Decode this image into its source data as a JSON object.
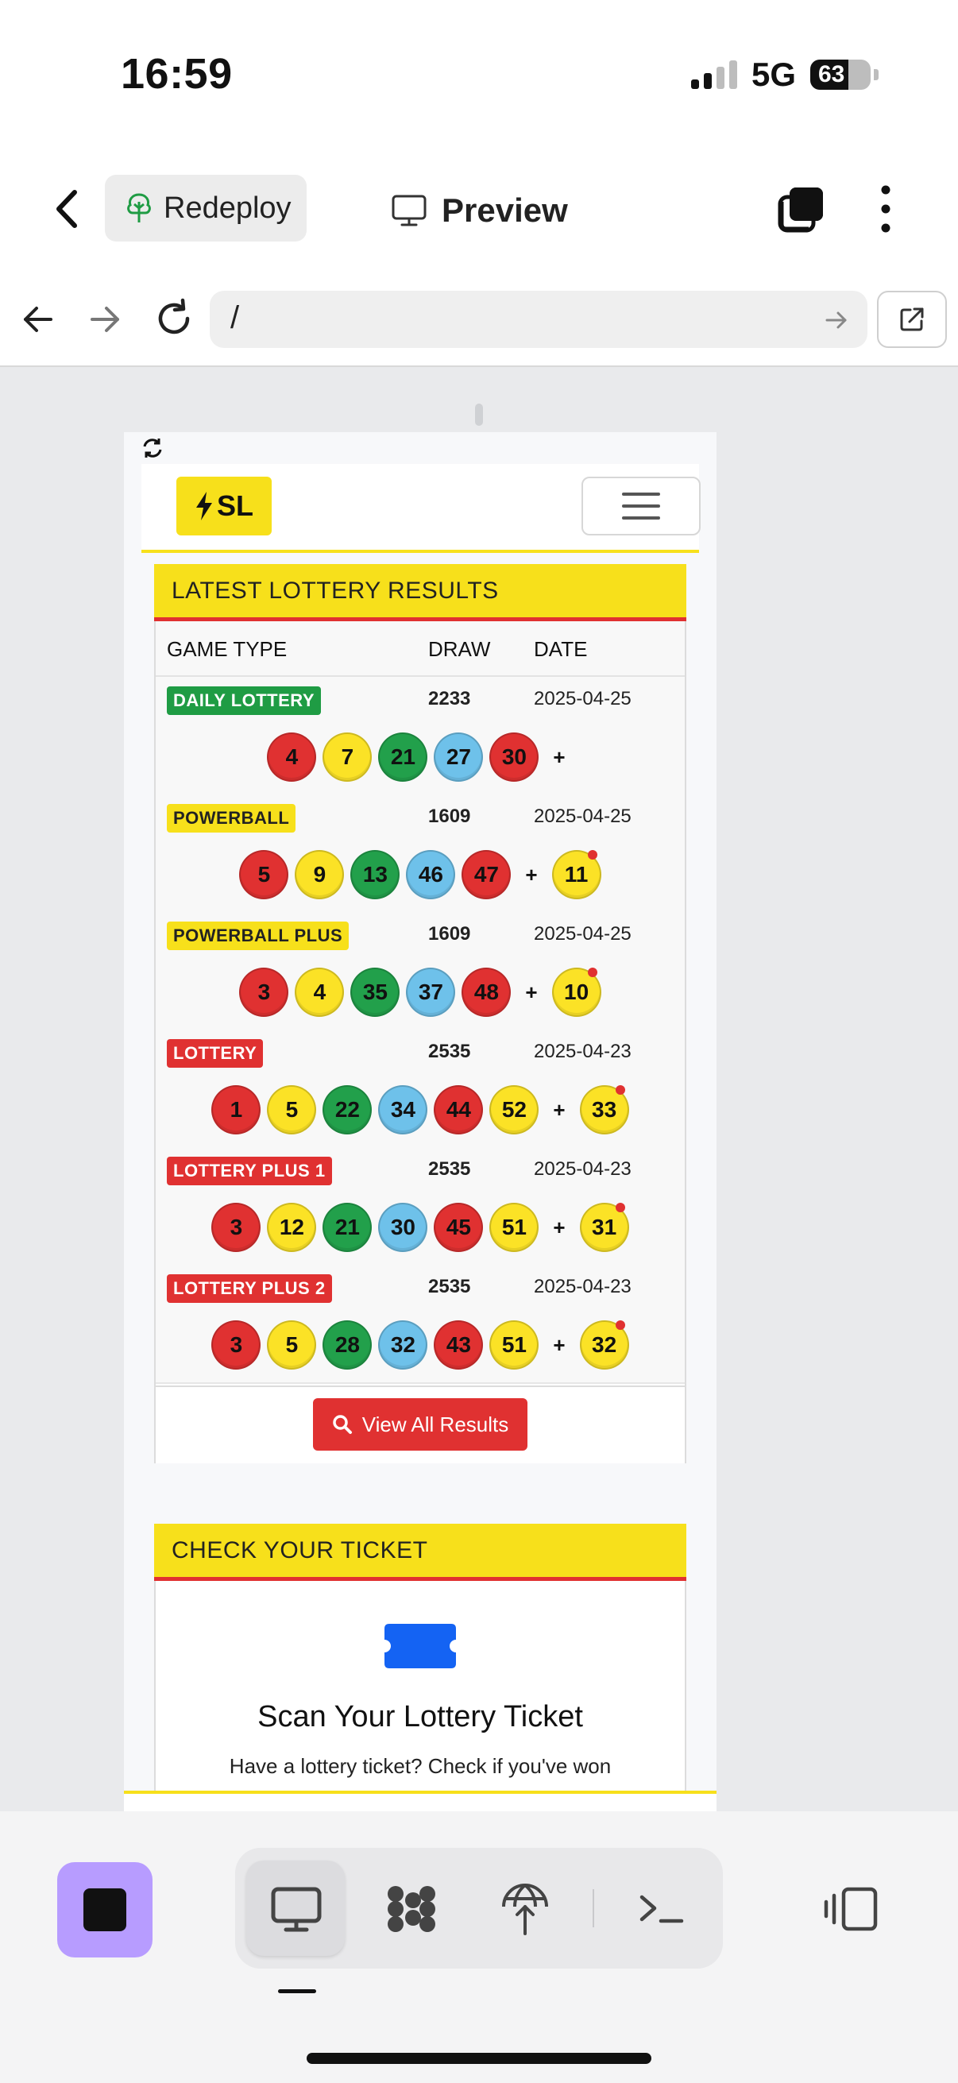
{
  "status_bar": {
    "time": "16:59",
    "network": "5G",
    "battery": "63",
    "battery_level": 0.63
  },
  "header": {
    "redeploy_label": "Redeploy",
    "preview_label": "Preview"
  },
  "url_bar": {
    "url": "/"
  },
  "site": {
    "logo_text": "SL",
    "results_title": "LATEST LOTTERY RESULTS",
    "columns": {
      "game_type": "GAME TYPE",
      "draw": "DRAW",
      "date": "DATE"
    },
    "plus_sign": "+",
    "games": [
      {
        "name": "DAILY LOTTERY",
        "badge_color": "green",
        "draw": "2233",
        "date": "2025-04-25",
        "numbers": [
          {
            "n": "4",
            "c": "red"
          },
          {
            "n": "7",
            "c": "yellow"
          },
          {
            "n": "21",
            "c": "green"
          },
          {
            "n": "27",
            "c": "blue"
          },
          {
            "n": "30",
            "c": "red"
          }
        ],
        "bonus": ""
      },
      {
        "name": "POWERBALL",
        "badge_color": "yellow",
        "draw": "1609",
        "date": "2025-04-25",
        "numbers": [
          {
            "n": "5",
            "c": "red"
          },
          {
            "n": "9",
            "c": "yellow"
          },
          {
            "n": "13",
            "c": "green"
          },
          {
            "n": "46",
            "c": "blue"
          },
          {
            "n": "47",
            "c": "red"
          }
        ],
        "bonus": "11"
      },
      {
        "name": "POWERBALL PLUS",
        "badge_color": "yellow",
        "draw": "1609",
        "date": "2025-04-25",
        "numbers": [
          {
            "n": "3",
            "c": "red"
          },
          {
            "n": "4",
            "c": "yellow"
          },
          {
            "n": "35",
            "c": "green"
          },
          {
            "n": "37",
            "c": "blue"
          },
          {
            "n": "48",
            "c": "red"
          }
        ],
        "bonus": "10"
      },
      {
        "name": "LOTTERY",
        "badge_color": "red",
        "draw": "2535",
        "date": "2025-04-23",
        "numbers": [
          {
            "n": "1",
            "c": "red"
          },
          {
            "n": "5",
            "c": "yellow"
          },
          {
            "n": "22",
            "c": "green"
          },
          {
            "n": "34",
            "c": "blue"
          },
          {
            "n": "44",
            "c": "red"
          },
          {
            "n": "52",
            "c": "yellow"
          }
        ],
        "bonus": "33"
      },
      {
        "name": "LOTTERY PLUS 1",
        "badge_color": "red",
        "draw": "2535",
        "date": "2025-04-23",
        "numbers": [
          {
            "n": "3",
            "c": "red"
          },
          {
            "n": "12",
            "c": "yellow"
          },
          {
            "n": "21",
            "c": "green"
          },
          {
            "n": "30",
            "c": "blue"
          },
          {
            "n": "45",
            "c": "red"
          },
          {
            "n": "51",
            "c": "yellow"
          }
        ],
        "bonus": "31"
      },
      {
        "name": "LOTTERY PLUS 2",
        "badge_color": "red",
        "draw": "2535",
        "date": "2025-04-23",
        "numbers": [
          {
            "n": "3",
            "c": "red"
          },
          {
            "n": "5",
            "c": "yellow"
          },
          {
            "n": "28",
            "c": "green"
          },
          {
            "n": "32",
            "c": "blue"
          },
          {
            "n": "43",
            "c": "red"
          },
          {
            "n": "51",
            "c": "yellow"
          }
        ],
        "bonus": "32"
      }
    ],
    "view_all_label": "View All Results",
    "ticket_title": "CHECK YOUR TICKET",
    "ticket_heading": "Scan Your Lottery Ticket",
    "ticket_sub": "Have a lottery ticket? Check if you've won"
  },
  "colors": {
    "brand_yellow": "#f7e01b",
    "brand_red": "#e03131",
    "ball_green": "#22a04b",
    "ball_blue": "#6ec1ea",
    "stop_purple": "#b79cff"
  }
}
